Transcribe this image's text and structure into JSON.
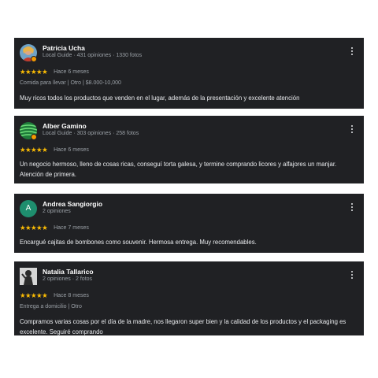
{
  "reviews": [
    {
      "name": "Patricia Ucha",
      "meta": "Local Guide · 431 opiniones · 1330 fotos",
      "stars": "★★★★★",
      "when": "Hace 6 meses",
      "tags": "Comida para llevar  |  Otro  |  $8.000-10,000",
      "text": "Muy ricos todos los productos que venden en el lugar, además de la presentación y excelente atención"
    },
    {
      "name": "Alber Gamino",
      "meta": "Local Guide · 303 opiniones · 258 fotos",
      "stars": "★★★★★",
      "when": "Hace 6 meses",
      "text": "Un negocio hermoso, lleno de cosas ricas, conseguí torta galesa, y termine comprando licores y alfajores un manjar. Atención de primera."
    },
    {
      "name": "Andrea Sangiorgio",
      "meta": "2 opiniones",
      "avatar_letter": "A",
      "stars": "★★★★★",
      "when": "Hace 7 meses",
      "text": "Encargué cajitas de bombones como souvenir. Hermosa entrega. Muy recomendables."
    },
    {
      "name": "Natalia Tallarico",
      "meta": "2 opiniones · 2 fotos",
      "stars": "★★★★★",
      "when": "Hace 8 meses",
      "tags": "Entrega a domicilio  |  Otro",
      "text": "Compramos varias cosas por el día de la madre, nos llegaron super bien y la calidad de los productos y el packaging es excelente. Seguiré comprando"
    }
  ],
  "colors": {
    "card_bg": "#202124",
    "star": "#fbbc04",
    "meta": "#9aa0a6",
    "avatar_a": "#1e8e6e"
  },
  "icons": [
    "more-vert-icon",
    "local-guide-badge-icon"
  ]
}
